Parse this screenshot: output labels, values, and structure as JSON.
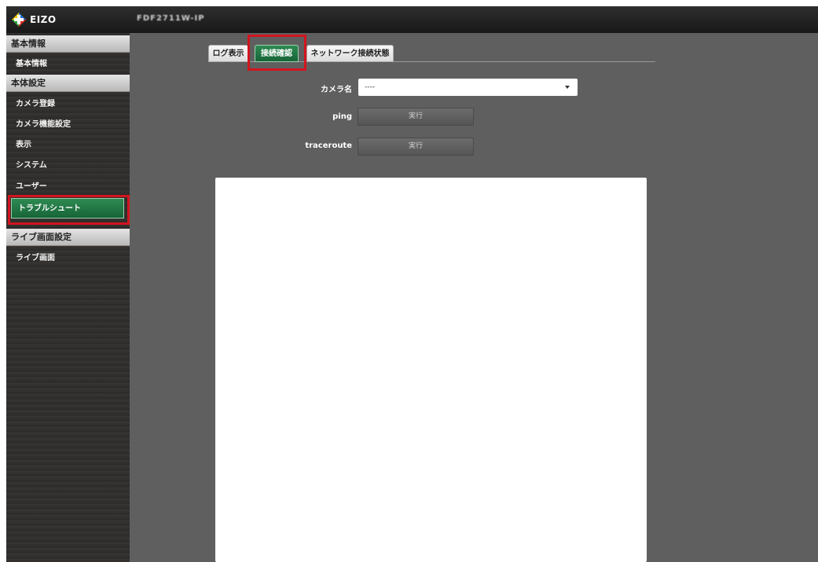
{
  "header": {
    "logo_text": "EIZO",
    "device_name": "FDF2711W-IP"
  },
  "sidebar": {
    "sections": [
      {
        "label": "基本情報",
        "items": [
          {
            "label": "基本情報"
          }
        ]
      },
      {
        "label": "本体設定",
        "items": [
          {
            "label": "カメラ登録"
          },
          {
            "label": "カメラ機能設定"
          },
          {
            "label": "表示"
          },
          {
            "label": "システム"
          },
          {
            "label": "ユーザー"
          },
          {
            "label": "トラブルシュート",
            "active": true
          }
        ]
      },
      {
        "label": "ライブ画面設定",
        "items": [
          {
            "label": "ライブ画面"
          }
        ]
      }
    ]
  },
  "tabs": [
    {
      "label": "ログ表示"
    },
    {
      "label": "接続確認",
      "active": true
    },
    {
      "label": "ネットワーク接続状態"
    }
  ],
  "form": {
    "camera_name_label": "カメラ名",
    "camera_name_value": "----",
    "ping_label": "ping",
    "ping_button": "実行",
    "traceroute_label": "traceroute",
    "traceroute_button": "実行"
  },
  "colors": {
    "highlight": "#d2151f",
    "active_green": "#1f7a45",
    "content_bg": "#5f5f5f"
  }
}
